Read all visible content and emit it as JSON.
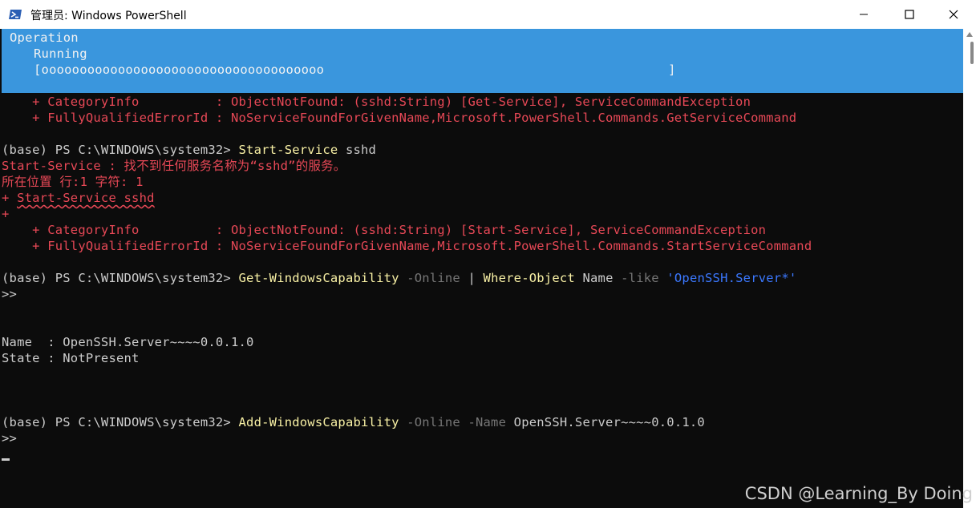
{
  "window": {
    "title": "管理员: Windows PowerShell",
    "icons": [
      "powershell-icon",
      "minimize-icon",
      "maximize-icon",
      "close-icon"
    ]
  },
  "progress": {
    "activity": "Operation",
    "status": "Running",
    "bar": "[ooooooooooooooooooooooooooooooooooooo                                             ]"
  },
  "lines": [
    {
      "segments": [
        {
          "text": "    + CategoryInfo          : ObjectNotFound: (sshd:String) [Get-Service], ServiceCommandException",
          "color": "red"
        }
      ]
    },
    {
      "segments": [
        {
          "text": "    + FullyQualifiedErrorId : NoServiceFoundForGivenName,Microsoft.PowerShell.Commands.GetServiceCommand",
          "color": "red"
        }
      ]
    },
    {
      "segments": []
    },
    {
      "segments": [
        {
          "text": "(base) PS C:\\WINDOWS\\system32> ",
          "color": "white"
        },
        {
          "text": "Start-Service",
          "color": "yellow"
        },
        {
          "text": " sshd",
          "color": "white"
        }
      ]
    },
    {
      "segments": [
        {
          "text": "Start-Service : 找不到任何服务名称为“sshd”的服务。",
          "color": "red"
        }
      ]
    },
    {
      "segments": [
        {
          "text": "所在位置 行:1 字符: 1",
          "color": "red"
        }
      ]
    },
    {
      "segments": [
        {
          "text": "+ ",
          "color": "red"
        },
        {
          "text": "Start-Service sshd",
          "color": "red",
          "squiggle": true
        }
      ]
    },
    {
      "segments": [
        {
          "text": "+",
          "color": "red"
        }
      ]
    },
    {
      "segments": [
        {
          "text": "    + CategoryInfo          : ObjectNotFound: (sshd:String) [Start-Service], ServiceCommandException",
          "color": "red"
        }
      ]
    },
    {
      "segments": [
        {
          "text": "    + FullyQualifiedErrorId : NoServiceFoundForGivenName,Microsoft.PowerShell.Commands.StartServiceCommand",
          "color": "red"
        }
      ]
    },
    {
      "segments": []
    },
    {
      "segments": [
        {
          "text": "(base) PS C:\\WINDOWS\\system32> ",
          "color": "white"
        },
        {
          "text": "Get-WindowsCapability",
          "color": "yellow"
        },
        {
          "text": " -Online",
          "color": "gray"
        },
        {
          "text": " | ",
          "color": "white"
        },
        {
          "text": "Where-Object",
          "color": "yellow"
        },
        {
          "text": " Name ",
          "color": "white"
        },
        {
          "text": "-like",
          "color": "gray"
        },
        {
          "text": " 'OpenSSH.Server*'",
          "color": "cyan"
        }
      ]
    },
    {
      "segments": [
        {
          "text": ">>",
          "color": "white"
        }
      ]
    },
    {
      "segments": []
    },
    {
      "segments": []
    },
    {
      "segments": [
        {
          "text": "Name  : OpenSSH.Server~~~~0.0.1.0",
          "color": "white"
        }
      ]
    },
    {
      "segments": [
        {
          "text": "State : NotPresent",
          "color": "white"
        }
      ]
    },
    {
      "segments": []
    },
    {
      "segments": []
    },
    {
      "segments": []
    },
    {
      "segments": [
        {
          "text": "(base) PS C:\\WINDOWS\\system32> ",
          "color": "white"
        },
        {
          "text": "Add-WindowsCapability",
          "color": "yellow"
        },
        {
          "text": " -Online -Name",
          "color": "gray"
        },
        {
          "text": " OpenSSH.Server~~~~0.0.1.0",
          "color": "white"
        }
      ]
    },
    {
      "segments": [
        {
          "text": ">>",
          "color": "white"
        }
      ]
    }
  ],
  "watermark": "CSDN @Learning_By Doing"
}
